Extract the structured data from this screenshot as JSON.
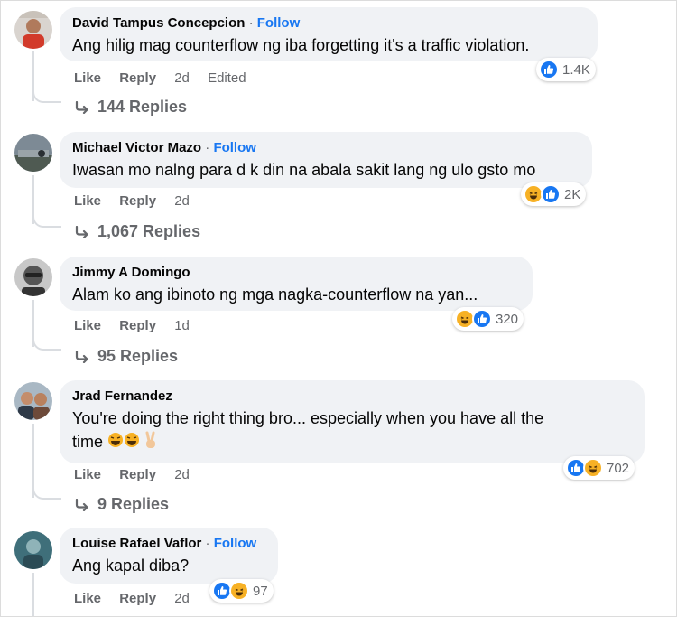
{
  "comments": [
    {
      "author": "David Tampus Concepcion",
      "follow": "Follow",
      "text": "Ang hilig mag counterflow ng iba forgetting it's a traffic violation.",
      "actions": {
        "like": "Like",
        "reply": "Reply",
        "time": "2d",
        "edited": "Edited"
      },
      "reactions": {
        "types": [
          "like"
        ],
        "count": "1.4K"
      },
      "replies": "144 Replies"
    },
    {
      "author": "Michael Victor Mazo",
      "follow": "Follow",
      "text": "Iwasan mo nalng para d k din na abala sakit lang ng ulo gsto mo",
      "actions": {
        "like": "Like",
        "reply": "Reply",
        "time": "2d"
      },
      "reactions": {
        "types": [
          "haha",
          "like"
        ],
        "count": "2K"
      },
      "replies": "1,067 Replies"
    },
    {
      "author": "Jimmy A Domingo",
      "text": "Alam ko ang ibinoto ng mga nagka-counterflow na yan...",
      "actions": {
        "like": "Like",
        "reply": "Reply",
        "time": "1d"
      },
      "reactions": {
        "types": [
          "haha",
          "like"
        ],
        "count": "320"
      },
      "replies": "95 Replies"
    },
    {
      "author": "Jrad Fernandez",
      "text_line1": "You're doing the right thing bro... especially when you have all the",
      "text_line2": "time",
      "actions": {
        "like": "Like",
        "reply": "Reply",
        "time": "2d"
      },
      "reactions": {
        "types": [
          "like",
          "haha"
        ],
        "count": "702"
      },
      "replies": "9 Replies"
    },
    {
      "author": "Louise Rafael Vaflor",
      "follow": "Follow",
      "text": "Ang kapal diba?",
      "actions": {
        "like": "Like",
        "reply": "Reply",
        "time": "2d"
      },
      "reactions": {
        "types": [
          "like",
          "haha"
        ],
        "count": "97"
      }
    }
  ],
  "colors": {
    "follow": "#1877f2",
    "bubble": "#f0f2f5",
    "meta": "#65676b",
    "like": "#1877f2",
    "haha": "#f7b125"
  }
}
